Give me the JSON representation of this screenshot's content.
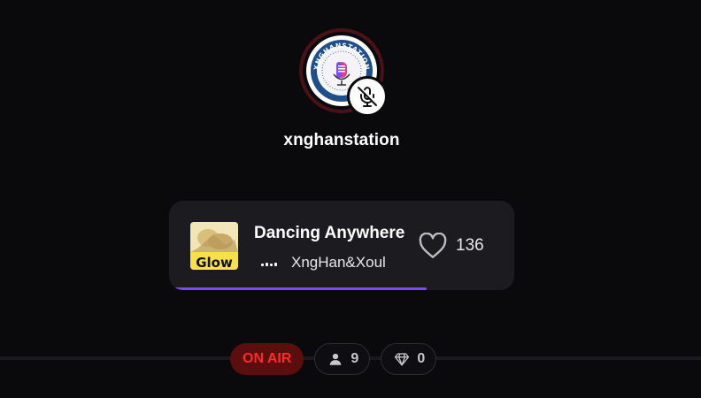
{
  "host": {
    "username": "xnghanstation",
    "avatar_text": "XNGHANSTATION",
    "mic_status": "muted"
  },
  "now_playing": {
    "title": "Dancing Anywhere",
    "artist": "XngHan&Xoul",
    "album_art_text": "Glow",
    "likes": "136",
    "progress": 0.73
  },
  "status": {
    "on_air_label": "ON AIR",
    "listeners": "9",
    "gems": "0"
  },
  "icons": {
    "mute": "mic-off-icon",
    "like": "heart-icon",
    "listeners": "person-icon",
    "gems": "diamond-icon"
  },
  "colors": {
    "background": "#0a090c",
    "card": "#1c1b20",
    "accent": "#7a4df2",
    "on_air_bg": "#5a0e0e",
    "on_air_text": "#ff2a2a"
  }
}
